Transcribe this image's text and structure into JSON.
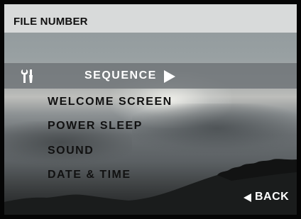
{
  "header": {
    "title": "FILE NUMBER"
  },
  "menu": {
    "selected": {
      "label": "SEQUENCE",
      "icon": "tools-icon",
      "arrow_icon": "arrow-right-icon"
    },
    "items": [
      {
        "label": "WELCOME SCREEN"
      },
      {
        "label": "POWER SLEEP"
      },
      {
        "label": "SOUND"
      },
      {
        "label": "DATE & TIME"
      }
    ]
  },
  "footer": {
    "back_label": "BACK",
    "back_icon": "arrow-left-icon"
  },
  "colors": {
    "header_bg": "#d8dada",
    "highlight_bg": "#6e7376",
    "text_dark": "#111111",
    "text_light": "#ffffff"
  }
}
